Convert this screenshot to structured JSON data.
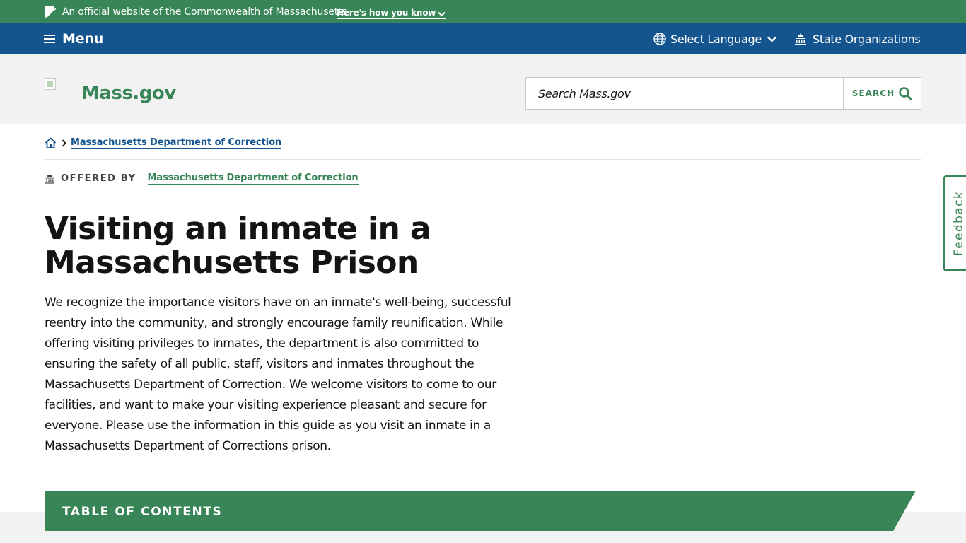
{
  "official_banner": {
    "text": "An official website of the Commonwealth of Massachusetts",
    "how_link": "Here's how you know"
  },
  "utility_nav": {
    "menu_label": "Menu",
    "language_label": "Select Language",
    "orgs_label": "State Organizations"
  },
  "header": {
    "logo_text": "Mass.gov",
    "search_placeholder": "Search Mass.gov",
    "search_button": "SEARCH"
  },
  "breadcrumb": {
    "items": [
      {
        "label": "Massachusetts Department of Correction"
      }
    ]
  },
  "offered_by": {
    "label": "OFFERED BY",
    "org": "Massachusetts Department of Correction"
  },
  "page": {
    "title": "Visiting an inmate in a Massachusetts Prison",
    "intro": "We recognize the importance visitors have on an inmate's well-being, successful reentry into the community, and strongly encourage family reunification. While offering visiting privileges to inmates, the department is also committed to ensuring the safety of all public, staff, visitors and inmates throughout the Massachusetts Department of Correction. We welcome visitors to come to our facilities, and want to make your visiting experience pleasant and secure for everyone. Please use the information in this guide as you visit an inmate in a Massachusetts Department of Corrections prison."
  },
  "toc": {
    "label": "TABLE OF CONTENTS"
  },
  "feedback": {
    "label": "Feedback"
  },
  "colors": {
    "brand_green": "#388557",
    "nav_blue": "#14558f",
    "header_gray": "#f2f2f2"
  },
  "icons": [
    "flag-icon",
    "chevron-down-icon",
    "hamburger-icon",
    "globe-icon",
    "building-icon",
    "search-icon",
    "home-icon",
    "chevron-right-icon"
  ]
}
